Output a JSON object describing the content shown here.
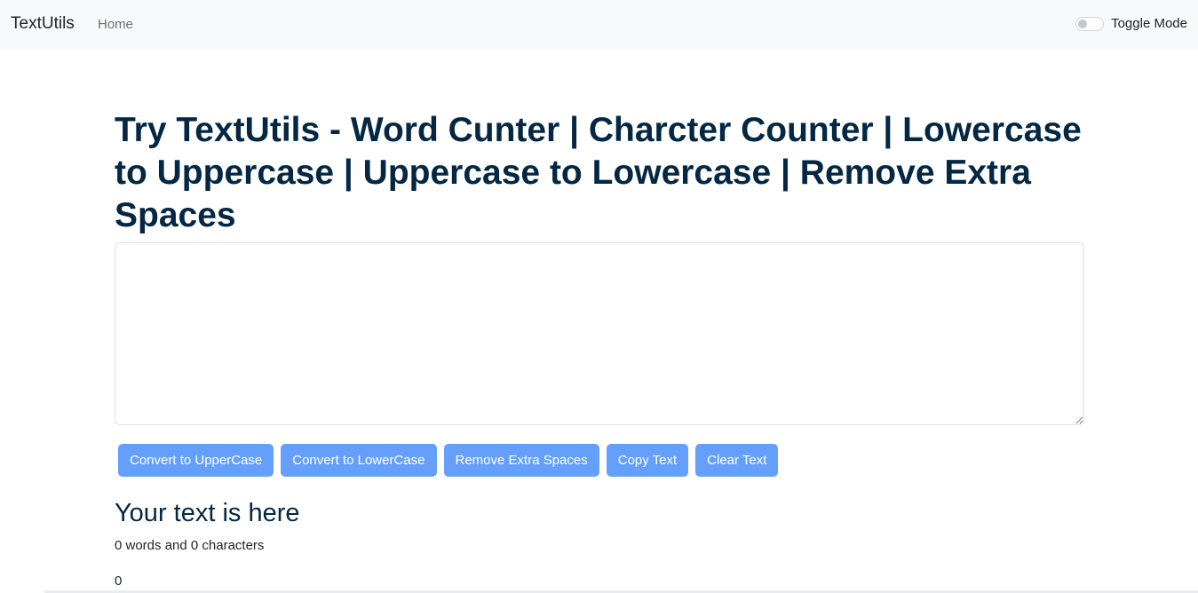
{
  "navbar": {
    "brand": "TextUtils",
    "home_link": "Home",
    "toggle_label": "Toggle Mode"
  },
  "main": {
    "heading": "Try TextUtils - Word Cunter | Charcter Counter | Lowercase to Uppercase | Uppercase to Lowercase | Remove Extra Spaces",
    "textarea_value": "",
    "buttons": {
      "uppercase": "Convert to UpperCase",
      "lowercase": "Convert to LowerCase",
      "remove_spaces": "Remove Extra Spaces",
      "copy": "Copy Text",
      "clear": "Clear Text"
    }
  },
  "summary": {
    "heading": "Your text is here",
    "counts": "0 words and 0 characters",
    "read_time": "0"
  },
  "colors": {
    "navbar_bg": "#f8f9fa",
    "heading_text": "#042743",
    "button_bg": "#64a0fb",
    "button_text": "#ffffff"
  },
  "icons": {
    "toggle": "toggle-switch-icon"
  }
}
